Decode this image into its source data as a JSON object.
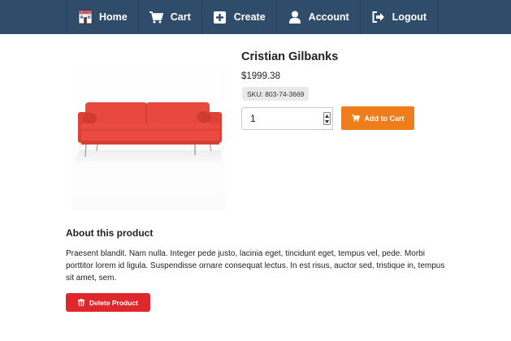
{
  "nav": {
    "items": [
      {
        "label": "Home",
        "icon": "home-icon"
      },
      {
        "label": "Cart",
        "icon": "cart-icon"
      },
      {
        "label": "Create",
        "icon": "plus-square-icon"
      },
      {
        "label": "Account",
        "icon": "user-icon"
      },
      {
        "label": "Logout",
        "icon": "logout-icon"
      }
    ]
  },
  "product": {
    "title": "Cristian Gilbanks",
    "price": "$1999.38",
    "sku": "SKU: 803-74-3669",
    "quantity": "1",
    "add_to_cart_label": "Add to Cart",
    "image_icon": "sofa-image"
  },
  "about": {
    "heading": "About this product",
    "description": "Praesent blandit. Nam nulla. Integer pede justo, lacinia eget, tincidunt eget, tempus vel, pede. Morbi porttitor lorem id ligula. Suspendisse ornare consequat lectus. In est risus, auctor sed, tristique in, tempus sit amet, sem.",
    "delete_label": "Delete Product"
  },
  "colors": {
    "navbar": "#2f4d6b",
    "add_to_cart": "#f07d1b",
    "delete": "#e0282c",
    "sofa": "#e8493f"
  }
}
